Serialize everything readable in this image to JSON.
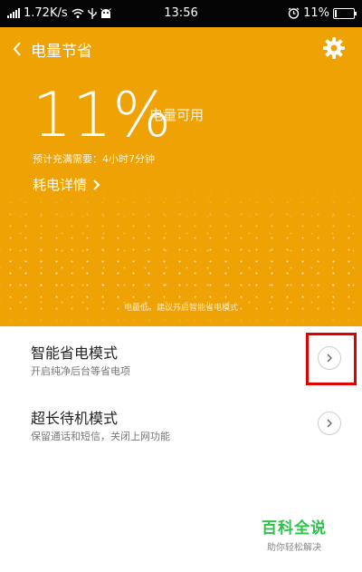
{
  "status_bar": {
    "speed": "1.72K/s",
    "time": "13:56",
    "battery_percent": "11%",
    "battery_level": 0.11
  },
  "header": {
    "title": "电量节省"
  },
  "battery": {
    "percent": "11%",
    "available_label": "电量可用",
    "eta": "预计充满需要：4小时7分钟",
    "detail_link": "耗电详情"
  },
  "tip": "电量低，建议开启智能省电模式",
  "modes": [
    {
      "title": "智能省电模式",
      "subtitle": "开启纯净后台等省电项"
    },
    {
      "title": "超长待机模式",
      "subtitle": "保留通话和短信，关闭上网功能"
    }
  ],
  "watermark": {
    "main": "百科全说",
    "sub": "助你轻松解决"
  },
  "colors": {
    "accent": "#efa203",
    "highlight": "#e00000",
    "watermark": "#2fc24a"
  },
  "icons": {
    "back": "chevron-left-icon",
    "settings": "gear-icon",
    "arrow": "chevron-right-icon"
  }
}
